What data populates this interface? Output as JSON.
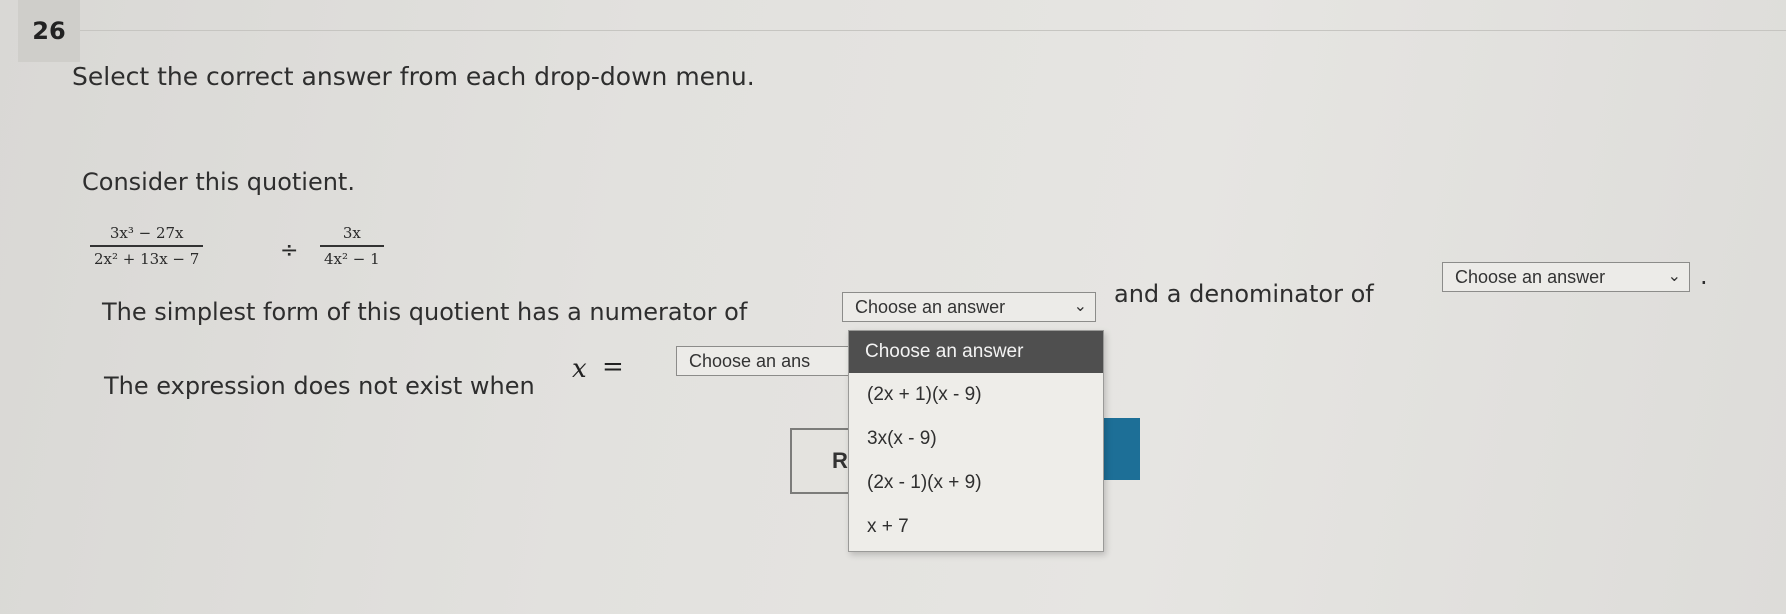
{
  "question": {
    "number": "26",
    "instruction": "Select the correct answer from each drop-down menu.",
    "prompt": "Consider this quotient."
  },
  "expression": {
    "left_num": "3x³ − 27x",
    "left_den": "2x² + 13x − 7",
    "operator": "÷",
    "right_num": "3x",
    "right_den": "4x² − 1"
  },
  "sentence1": {
    "before": "The simplest form of this quotient has a numerator of",
    "middle": "and a denominator of",
    "end": "."
  },
  "sentence2": {
    "before": "The expression does not exist when",
    "variable": "x",
    "equals": "="
  },
  "dropdowns": {
    "numerator": {
      "selected": "Choose an answer"
    },
    "denominator": {
      "selected": "Choose an answer"
    },
    "undefined_x": {
      "selected": "Choose an ans"
    }
  },
  "open_menu": {
    "header": "Choose an answer",
    "options": [
      "(2x + 1)(x - 9)",
      "3x(x - 9)",
      "(2x - 1)(x + 9)",
      "x + 7"
    ]
  },
  "buttons": {
    "reset_label": "R"
  },
  "icons": {
    "chevron": "chevron-down-icon"
  }
}
